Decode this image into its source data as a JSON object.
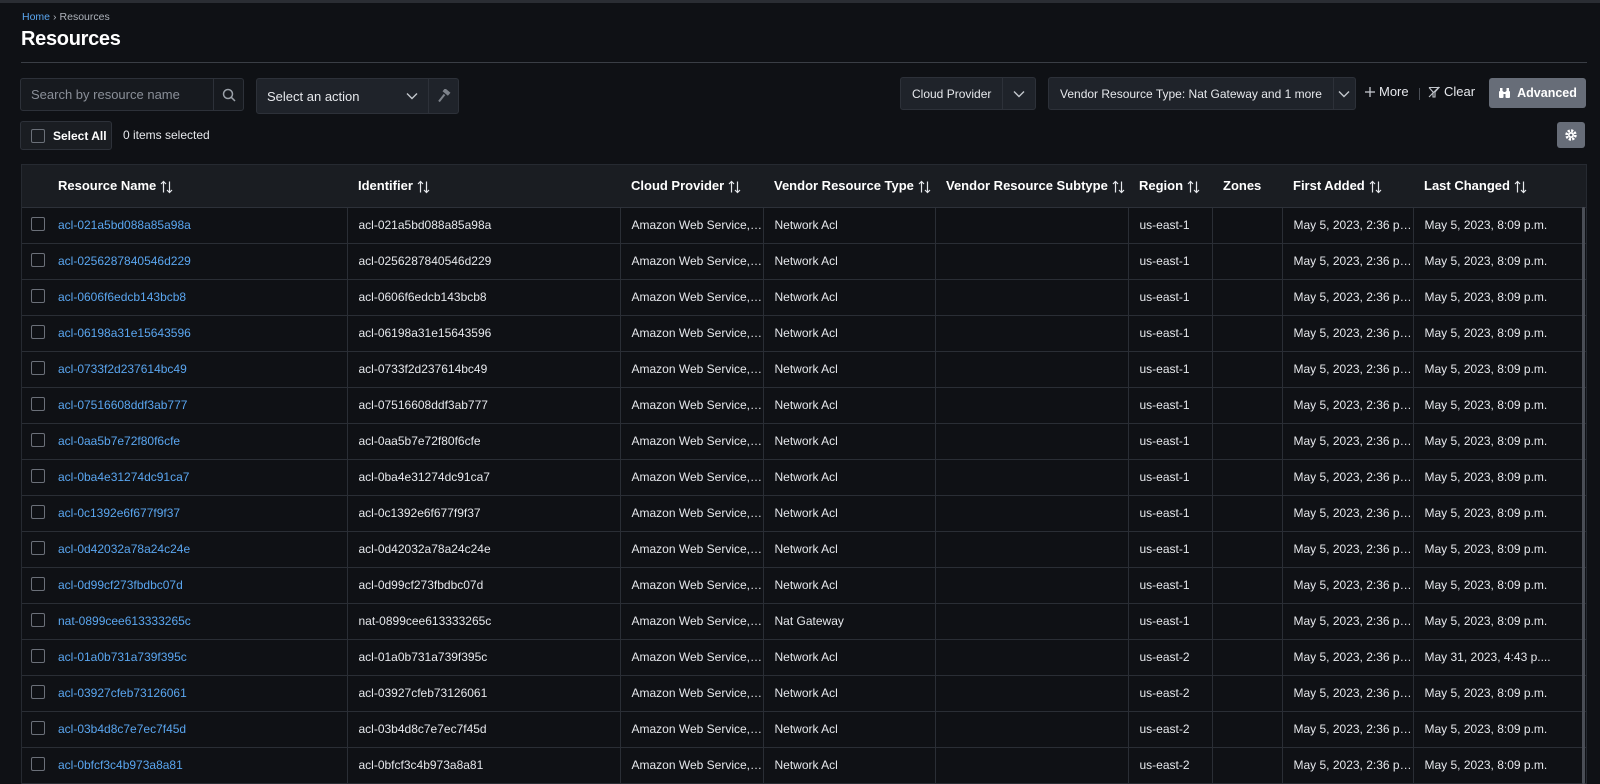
{
  "breadcrumb": {
    "home": "Home",
    "separator": "›",
    "current": "Resources"
  },
  "page": {
    "title": "Resources"
  },
  "search": {
    "placeholder": "Search by resource name",
    "value": "",
    "icon": "search-icon"
  },
  "action": {
    "placeholder": "Select an action",
    "run_icon": "hammer-icon"
  },
  "filters": {
    "cloud_provider": "Cloud Provider",
    "vendor_type": "Vendor Resource Type: Nat Gateway and 1 more",
    "more": "More",
    "clear": "Clear",
    "advanced": "Advanced"
  },
  "selection": {
    "select_all": "Select All",
    "count": "0 items selected"
  },
  "table": {
    "columns": [
      "Resource Name",
      "Identifier",
      "Cloud Provider",
      "Vendor Resource Type",
      "Vendor Resource Subtype",
      "Region",
      "Zones",
      "First Added",
      "Last Changed"
    ],
    "sortable": [
      true,
      true,
      true,
      true,
      true,
      true,
      false,
      true,
      true
    ],
    "rows": [
      [
        "acl-021a5bd088a85a98a",
        "acl-021a5bd088a85a98a",
        "Amazon Web Service, ...",
        "Network Acl",
        "",
        "us-east-1",
        "",
        "May 5, 2023, 2:36 p....",
        "May 5, 2023, 8:09 p.m."
      ],
      [
        "acl-0256287840546d229",
        "acl-0256287840546d229",
        "Amazon Web Service, ...",
        "Network Acl",
        "",
        "us-east-1",
        "",
        "May 5, 2023, 2:36 p....",
        "May 5, 2023, 8:09 p.m."
      ],
      [
        "acl-0606f6edcb143bcb8",
        "acl-0606f6edcb143bcb8",
        "Amazon Web Service, ...",
        "Network Acl",
        "",
        "us-east-1",
        "",
        "May 5, 2023, 2:36 p....",
        "May 5, 2023, 8:09 p.m."
      ],
      [
        "acl-06198a31e15643596",
        "acl-06198a31e15643596",
        "Amazon Web Service, ...",
        "Network Acl",
        "",
        "us-east-1",
        "",
        "May 5, 2023, 2:36 p....",
        "May 5, 2023, 8:09 p.m."
      ],
      [
        "acl-0733f2d237614bc49",
        "acl-0733f2d237614bc49",
        "Amazon Web Service, ...",
        "Network Acl",
        "",
        "us-east-1",
        "",
        "May 5, 2023, 2:36 p....",
        "May 5, 2023, 8:09 p.m."
      ],
      [
        "acl-07516608ddf3ab777",
        "acl-07516608ddf3ab777",
        "Amazon Web Service, ...",
        "Network Acl",
        "",
        "us-east-1",
        "",
        "May 5, 2023, 2:36 p....",
        "May 5, 2023, 8:09 p.m."
      ],
      [
        "acl-0aa5b7e72f80f6cfe",
        "acl-0aa5b7e72f80f6cfe",
        "Amazon Web Service, ...",
        "Network Acl",
        "",
        "us-east-1",
        "",
        "May 5, 2023, 2:36 p....",
        "May 5, 2023, 8:09 p.m."
      ],
      [
        "acl-0ba4e31274dc91ca7",
        "acl-0ba4e31274dc91ca7",
        "Amazon Web Service, ...",
        "Network Acl",
        "",
        "us-east-1",
        "",
        "May 5, 2023, 2:36 p....",
        "May 5, 2023, 8:09 p.m."
      ],
      [
        "acl-0c1392e6f677f9f37",
        "acl-0c1392e6f677f9f37",
        "Amazon Web Service, ...",
        "Network Acl",
        "",
        "us-east-1",
        "",
        "May 5, 2023, 2:36 p....",
        "May 5, 2023, 8:09 p.m."
      ],
      [
        "acl-0d42032a78a24c24e",
        "acl-0d42032a78a24c24e",
        "Amazon Web Service, ...",
        "Network Acl",
        "",
        "us-east-1",
        "",
        "May 5, 2023, 2:36 p....",
        "May 5, 2023, 8:09 p.m."
      ],
      [
        "acl-0d99cf273fbdbc07d",
        "acl-0d99cf273fbdbc07d",
        "Amazon Web Service, ...",
        "Network Acl",
        "",
        "us-east-1",
        "",
        "May 5, 2023, 2:36 p....",
        "May 5, 2023, 8:09 p.m."
      ],
      [
        "nat-0899cee613333265c",
        "nat-0899cee613333265c",
        "Amazon Web Service, ...",
        "Nat Gateway",
        "",
        "us-east-1",
        "",
        "May 5, 2023, 2:36 p....",
        "May 5, 2023, 8:09 p.m."
      ],
      [
        "acl-01a0b731a739f395c",
        "acl-01a0b731a739f395c",
        "Amazon Web Service, ...",
        "Network Acl",
        "",
        "us-east-2",
        "",
        "May 5, 2023, 2:36 p....",
        "May 31, 2023, 4:43 p...."
      ],
      [
        "acl-03927cfeb73126061",
        "acl-03927cfeb73126061",
        "Amazon Web Service, ...",
        "Network Acl",
        "",
        "us-east-2",
        "",
        "May 5, 2023, 2:36 p....",
        "May 5, 2023, 8:09 p.m."
      ],
      [
        "acl-03b4d8c7e7ec7f45d",
        "acl-03b4d8c7e7ec7f45d",
        "Amazon Web Service, ...",
        "Network Acl",
        "",
        "us-east-2",
        "",
        "May 5, 2023, 2:36 p....",
        "May 5, 2023, 8:09 p.m."
      ],
      [
        "acl-0bfcf3c4b973a8a81",
        "acl-0bfcf3c4b973a8a81",
        "Amazon Web Service, ...",
        "Network Acl",
        "",
        "us-east-2",
        "",
        "May 5, 2023, 2:36 p....",
        "May 5, 2023, 8:09 p.m."
      ]
    ]
  },
  "colors": {
    "background": "#0f1115",
    "link": "#5aa6f0",
    "header_bg": "#1a1d22",
    "button_gray": "#676d78"
  }
}
